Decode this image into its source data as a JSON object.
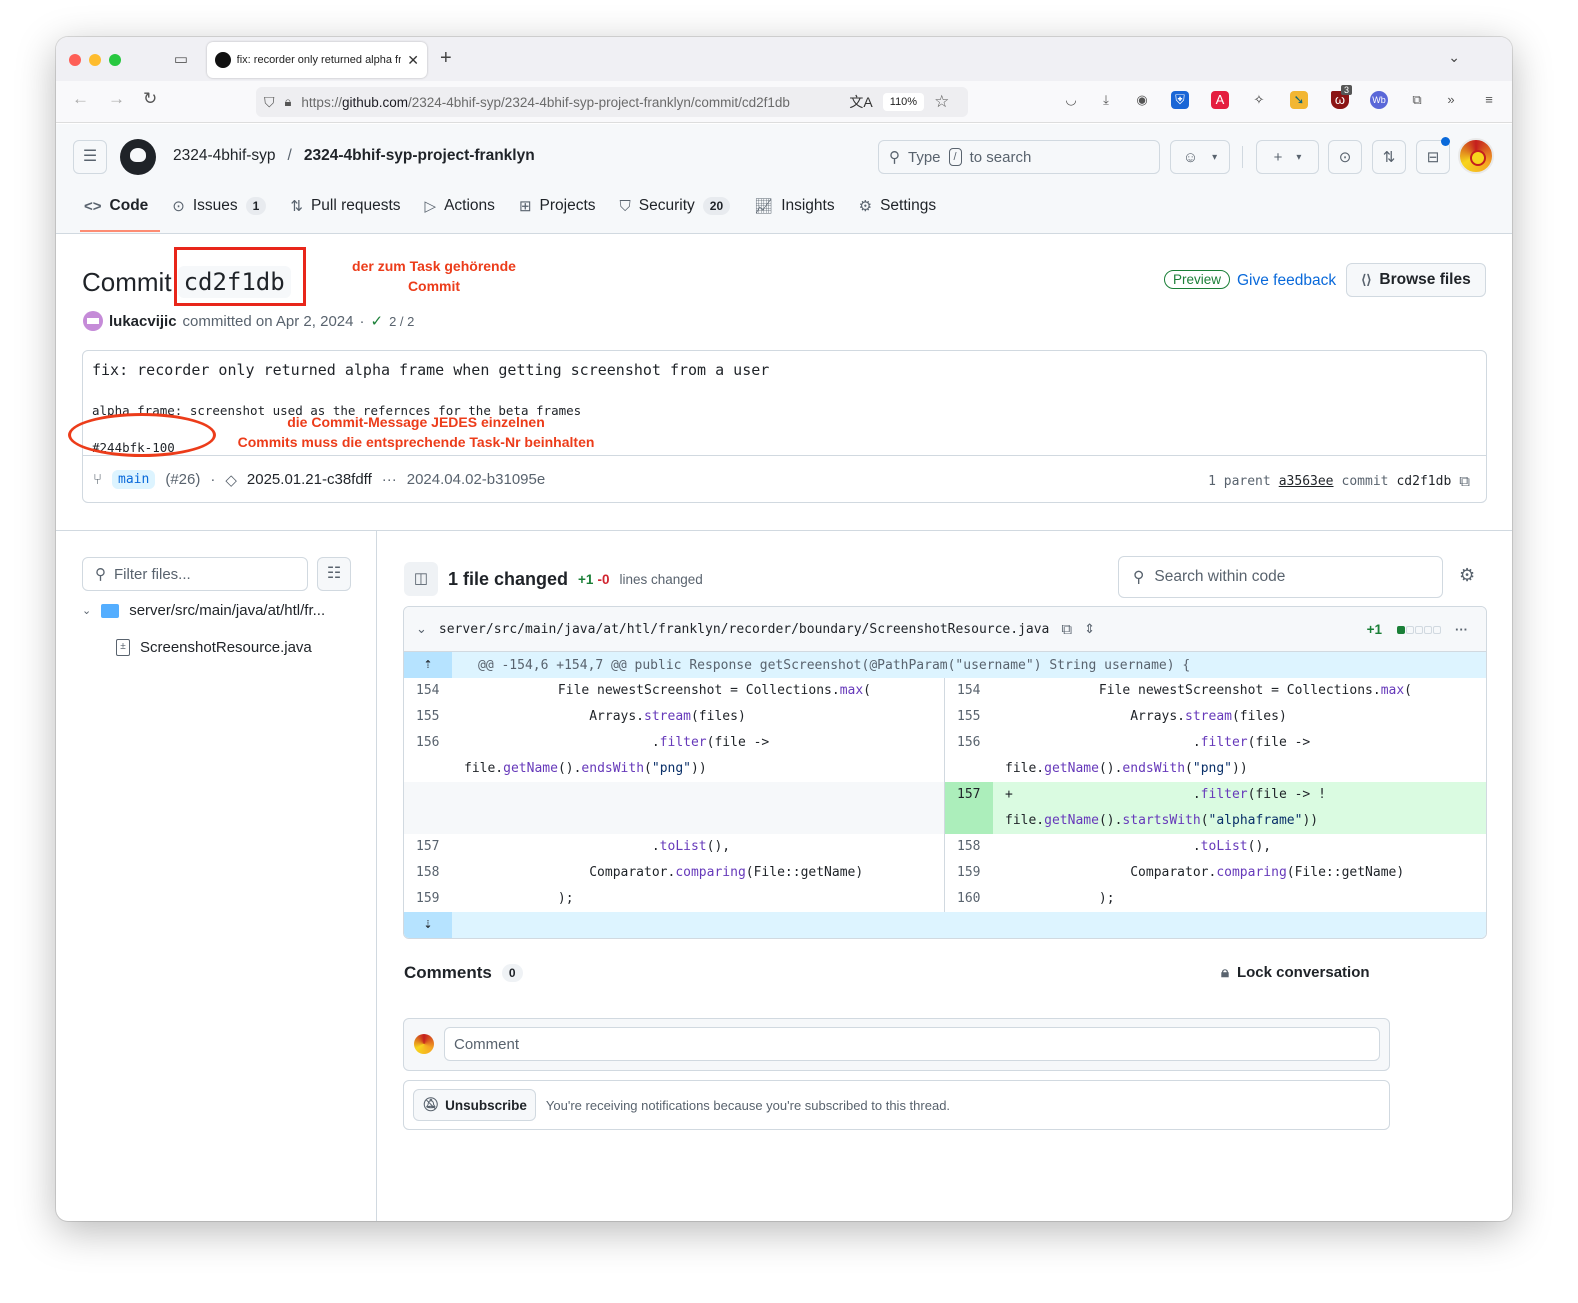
{
  "browser": {
    "tab_title": "fix: recorder only returned alpha frame when getting screenshot from a user",
    "url_prefix": "https://",
    "url_domain": "github.com",
    "url_path": "/2324-4bhif-syp/2324-4bhif-syp-project-franklyn/commit/cd2f1db",
    "zoom": "110%",
    "extension_badge": "3"
  },
  "header": {
    "owner": "2324-4bhif-syp",
    "separator": "/",
    "repo": "2324-4bhif-syp-project-franklyn",
    "search_pre": "Type",
    "search_key": "/",
    "search_post": "to search"
  },
  "repo_nav": [
    {
      "label": "Code",
      "icon": "code-icon",
      "active": true
    },
    {
      "label": "Issues",
      "icon": "issue-icon",
      "count": "1"
    },
    {
      "label": "Pull requests",
      "icon": "pull-request-icon"
    },
    {
      "label": "Actions",
      "icon": "play-icon"
    },
    {
      "label": "Projects",
      "icon": "table-icon"
    },
    {
      "label": "Security",
      "icon": "shield-icon",
      "count": "20"
    },
    {
      "label": "Insights",
      "icon": "graph-icon"
    },
    {
      "label": "Settings",
      "icon": "gear-icon"
    }
  ],
  "commit": {
    "title_label": "Commit",
    "sha_short": "cd2f1db",
    "author": "lukacvijic",
    "committed_text": "committed on Apr 2, 2024",
    "dot": "·",
    "checks": "2 / 2",
    "preview_label": "Preview",
    "feedback_label": "Give feedback",
    "browse_label": "Browse files",
    "message_title": "fix: recorder only returned alpha frame when getting screenshot from a user",
    "message_body": "alpha frame: screenshot used as the refernces for the beta frames",
    "message_task": "#244bfk-100",
    "branch": "main",
    "pr_ref": "(#26)",
    "tag_newest": "2025.01.21-c38fdff",
    "tag_ellipsis": "···",
    "tag_oldest": "2024.04.02-b31095e",
    "parent_label": "1 parent",
    "parent_sha": "a3563ee",
    "commit_label": "commit",
    "commit_sha": "cd2f1db"
  },
  "annotations": {
    "commit_note_line1": "der zum Task gehörende",
    "commit_note_line2": "Commit",
    "task_note_line1": "die Commit-Message JEDES einzelnen",
    "task_note_line2": "Commits muss die entsprechende Task-Nr beinhalten"
  },
  "sidebar": {
    "filter_placeholder": "Filter files...",
    "dir": "server/src/main/java/at/htl/fr...",
    "file": "ScreenshotResource.java"
  },
  "diff": {
    "files_changed": "1 file changed",
    "additions": "+1",
    "deletions": "-0",
    "lines_changed": "lines changed",
    "search_placeholder": "Search within code",
    "file_path": "server/src/main/java/at/htl/franklyn/recorder/boundary/ScreenshotResource.java",
    "file_additions": "+1",
    "hunk_header": "@@ -154,6 +154,7 @@ public Response getScreenshot(@PathParam(\"username\") String username) {",
    "left": [
      {
        "ln": "154",
        "code": "            File newestScreenshot = Collections.max("
      },
      {
        "ln": "155",
        "code": "                Arrays.stream(files)"
      },
      {
        "ln": "156",
        "code": "                        .filter(file ->",
        "wrap": "file.getName().endsWith(\"png\"))"
      },
      {
        "ln": "",
        "code": "",
        "empty": true
      },
      {
        "ln": "157",
        "code": "                        .toList(),"
      },
      {
        "ln": "158",
        "code": "                Comparator.comparing(File::getName)"
      },
      {
        "ln": "159",
        "code": "            );"
      }
    ],
    "right": [
      {
        "ln": "154",
        "code": "            File newestScreenshot = Collections.max("
      },
      {
        "ln": "155",
        "code": "                Arrays.stream(files)"
      },
      {
        "ln": "156",
        "code": "                        .filter(file ->",
        "wrap": "file.getName().endsWith(\"png\"))"
      },
      {
        "ln": "157",
        "code": "+                       .filter(file -> !",
        "wrap": "file.getName().startsWith(\"alphaframe\"))",
        "added": true
      },
      {
        "ln": "158",
        "code": "                        .toList(),"
      },
      {
        "ln": "159",
        "code": "                Comparator.comparing(File::getName)"
      },
      {
        "ln": "160",
        "code": "            );"
      }
    ]
  },
  "comments": {
    "title": "Comments",
    "count": "0",
    "lock_label": "Lock conversation",
    "comment_placeholder": "Comment",
    "unsubscribe_label": "Unsubscribe",
    "subscription_text": "You're receiving notifications because you're subscribed to this thread."
  },
  "colors": {
    "accent": "#0969da",
    "added": "#1a7f37",
    "deleted": "#d1242f",
    "annotation_red": "#ec3c1a",
    "active_tab_underline": "#fd8c73"
  }
}
